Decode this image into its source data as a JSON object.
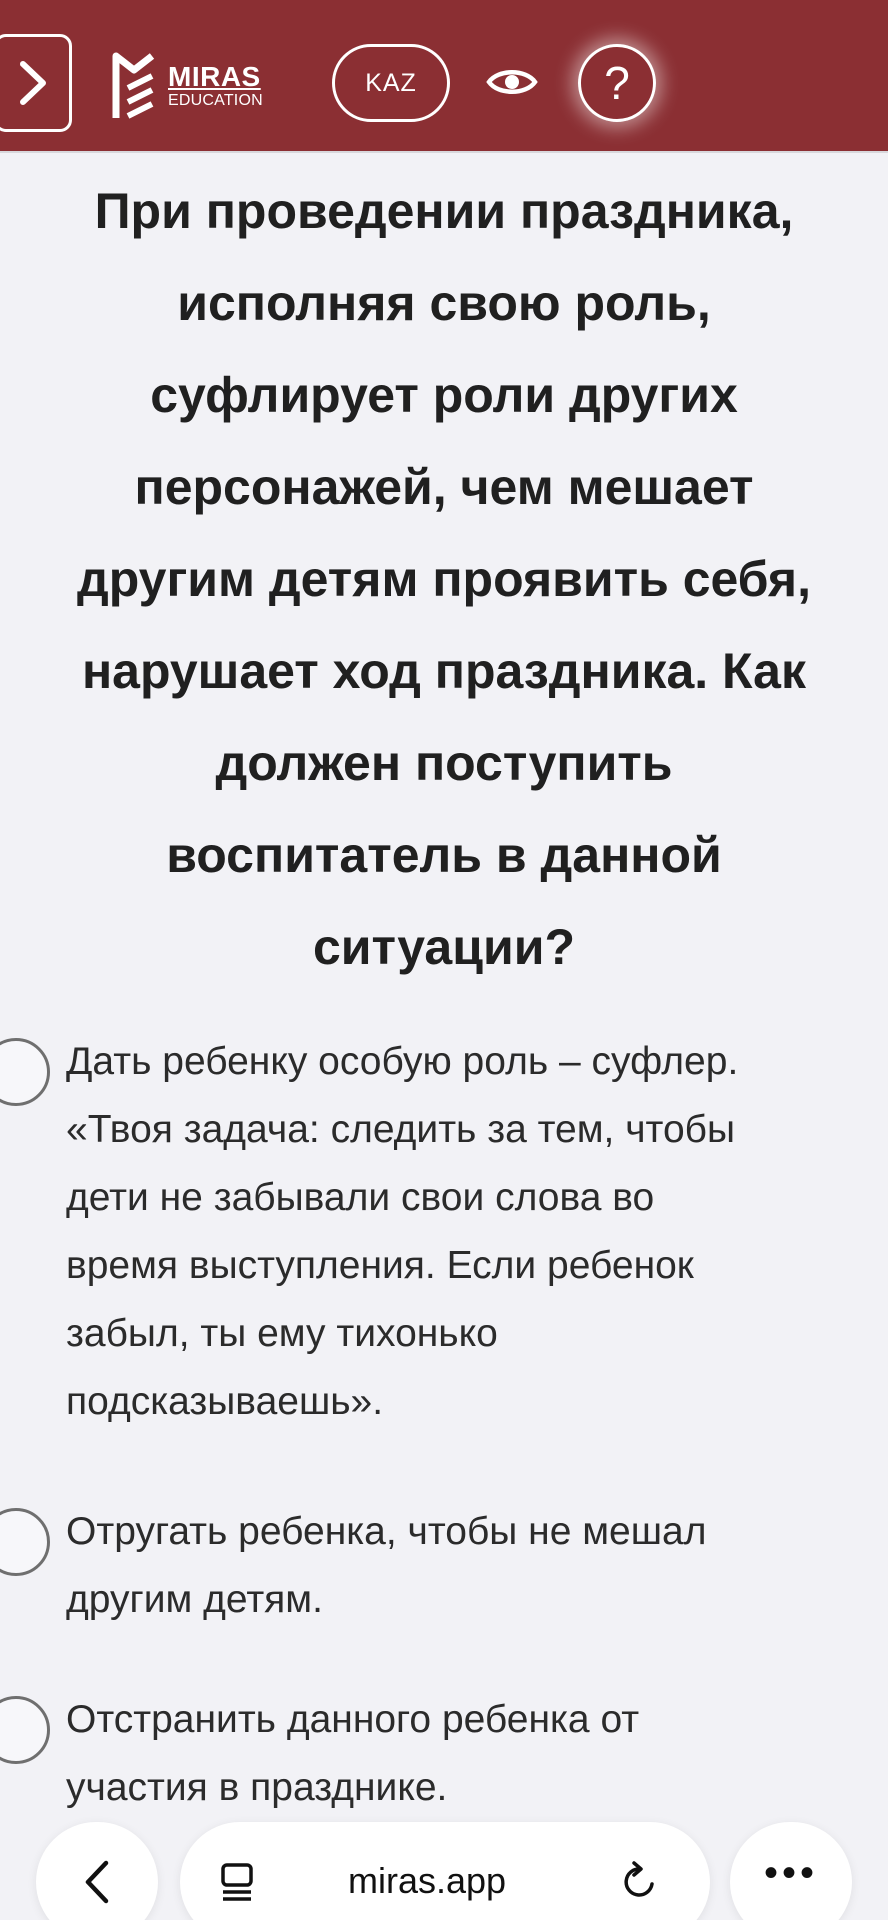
{
  "header": {
    "menu_icon": "chevron-right-icon",
    "logo": {
      "brand": "MIRAS",
      "sub": "EDUCATION"
    },
    "language_button": "KAZ",
    "eye_icon": "eye-icon",
    "help_button": "?",
    "colors": {
      "background": "#8b2f33",
      "foreground": "#ffffff"
    }
  },
  "question": {
    "text": "При проведении праздника,\nисполняя свою роль,\nсуфлирует роли других\nперсонажей, чем мешает\nдругим детям проявить себя,\nнарушает ход праздника. Как\nдолжен поступить\nвоспитатель в данной\nситуации?"
  },
  "options": [
    {
      "text": "Дать ребенку особую роль – суфлер.\n«Твоя задача: следить за тем, чтобы\nдети не забывали свои слова во\nвремя выступления. Если ребенок\nзабыл, ты ему тихонько\nподсказываешь».",
      "selected": false
    },
    {
      "text": "Отругать ребенка, чтобы не мешал\nдругим детям.",
      "selected": false
    },
    {
      "text": "Отстранить данного ребенка от\nучастия в празднике.",
      "selected": false
    }
  ],
  "browser": {
    "back_icon": "chevron-left-icon",
    "reader_icon": "reader-mode-icon",
    "url": "miras.app",
    "reload_icon": "reload-icon",
    "more_label": "•••"
  }
}
